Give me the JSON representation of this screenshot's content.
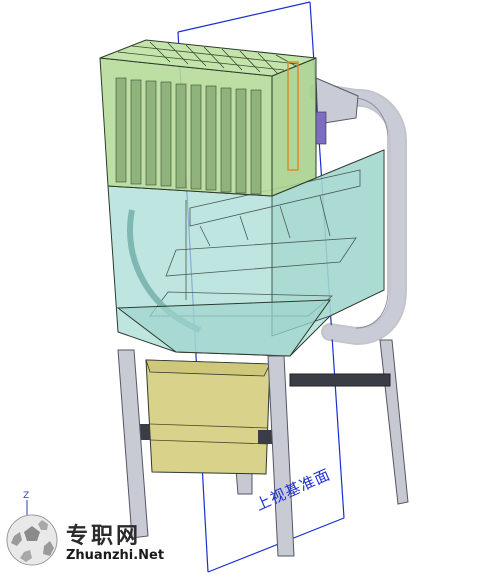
{
  "reference_plane_label": "上视基准面",
  "watermark": {
    "site_name": "专职网",
    "site_url": "Zhuanzhi.Net",
    "logo_icon": "soccer-ball-icon"
  },
  "triad": {
    "axis_label": "Z"
  },
  "colors": {
    "filter_housing": "#b6dc9a",
    "hopper_body": "#a8dcd4",
    "collection_bin": "#d8d28a",
    "duct_pipe": "#c9ccd6",
    "reference_plane": "#1b2fd0",
    "edge_lines": "#2d3a2d"
  }
}
